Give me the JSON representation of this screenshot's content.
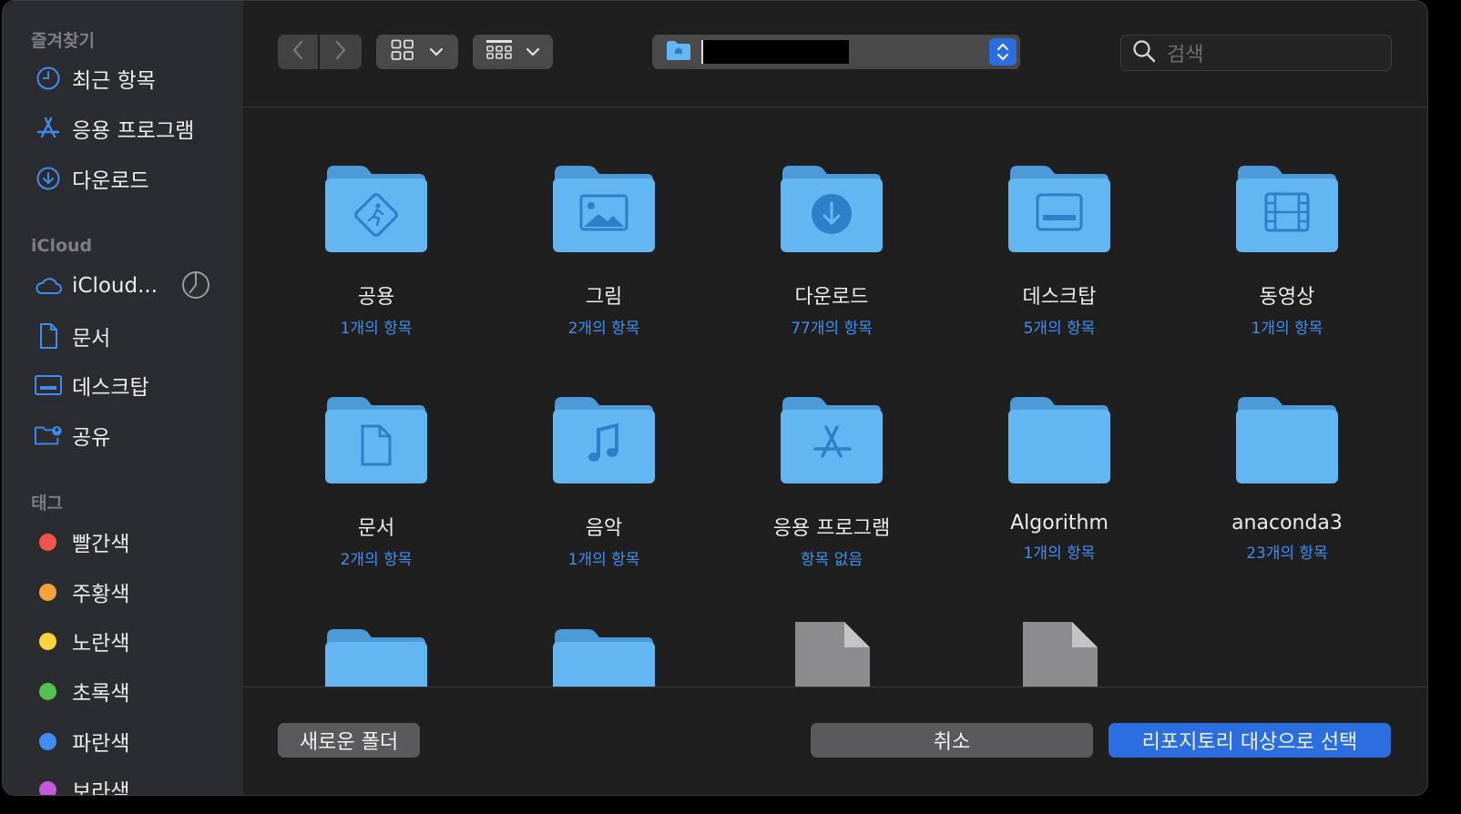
{
  "sidebar": {
    "favorites_title": "즐겨찾기",
    "favorites": [
      {
        "label": "최근 항목",
        "icon": "clock-icon"
      },
      {
        "label": "응용 프로그램",
        "icon": "app-store-icon"
      },
      {
        "label": "다운로드",
        "icon": "download-icon"
      }
    ],
    "icloud_title": "iCloud",
    "icloud": [
      {
        "label": "iCloud...",
        "icon": "cloud-icon"
      },
      {
        "label": "문서",
        "icon": "document-icon"
      },
      {
        "label": "데스크탑",
        "icon": "desktop-icon"
      },
      {
        "label": "공유",
        "icon": "shared-folder-icon"
      }
    ],
    "tags_title": "태그",
    "tags": [
      {
        "label": "빨간색",
        "color": "#f2544c"
      },
      {
        "label": "주황색",
        "color": "#f6a03a"
      },
      {
        "label": "노란색",
        "color": "#f8d33c"
      },
      {
        "label": "초록색",
        "color": "#52c24e"
      },
      {
        "label": "파란색",
        "color": "#3f8ef5"
      },
      {
        "label": "보라색",
        "color": "#c45ad9"
      }
    ]
  },
  "toolbar": {
    "search_placeholder": "검색",
    "path_value": ""
  },
  "items": [
    {
      "name": "공용",
      "count": "1개의 항목",
      "glyph": "public-icon"
    },
    {
      "name": "그림",
      "count": "2개의 항목",
      "glyph": "picture-icon"
    },
    {
      "name": "다운로드",
      "count": "77개의 항목",
      "glyph": "download-icon"
    },
    {
      "name": "데스크탑",
      "count": "5개의 항목",
      "glyph": "desktop-icon"
    },
    {
      "name": "동영상",
      "count": "1개의 항목",
      "glyph": "film-icon"
    },
    {
      "name": "문서",
      "count": "2개의 항목",
      "glyph": "document-icon"
    },
    {
      "name": "음악",
      "count": "1개의 항목",
      "glyph": "music-icon"
    },
    {
      "name": "응용 프로그램",
      "count": "항목 없음",
      "glyph": "app-store-icon"
    },
    {
      "name": "Algorithm",
      "count": "1개의 항목",
      "glyph": "none"
    },
    {
      "name": "anaconda3",
      "count": "23개의 항목",
      "glyph": "none"
    }
  ],
  "footer": {
    "new_folder": "새로운 폴더",
    "cancel": "취소",
    "select": "리포지토리 대상으로 선택"
  },
  "colors": {
    "accent": "#2a6ee0",
    "folder": "#62b6f2",
    "link": "#3f8ff0"
  }
}
